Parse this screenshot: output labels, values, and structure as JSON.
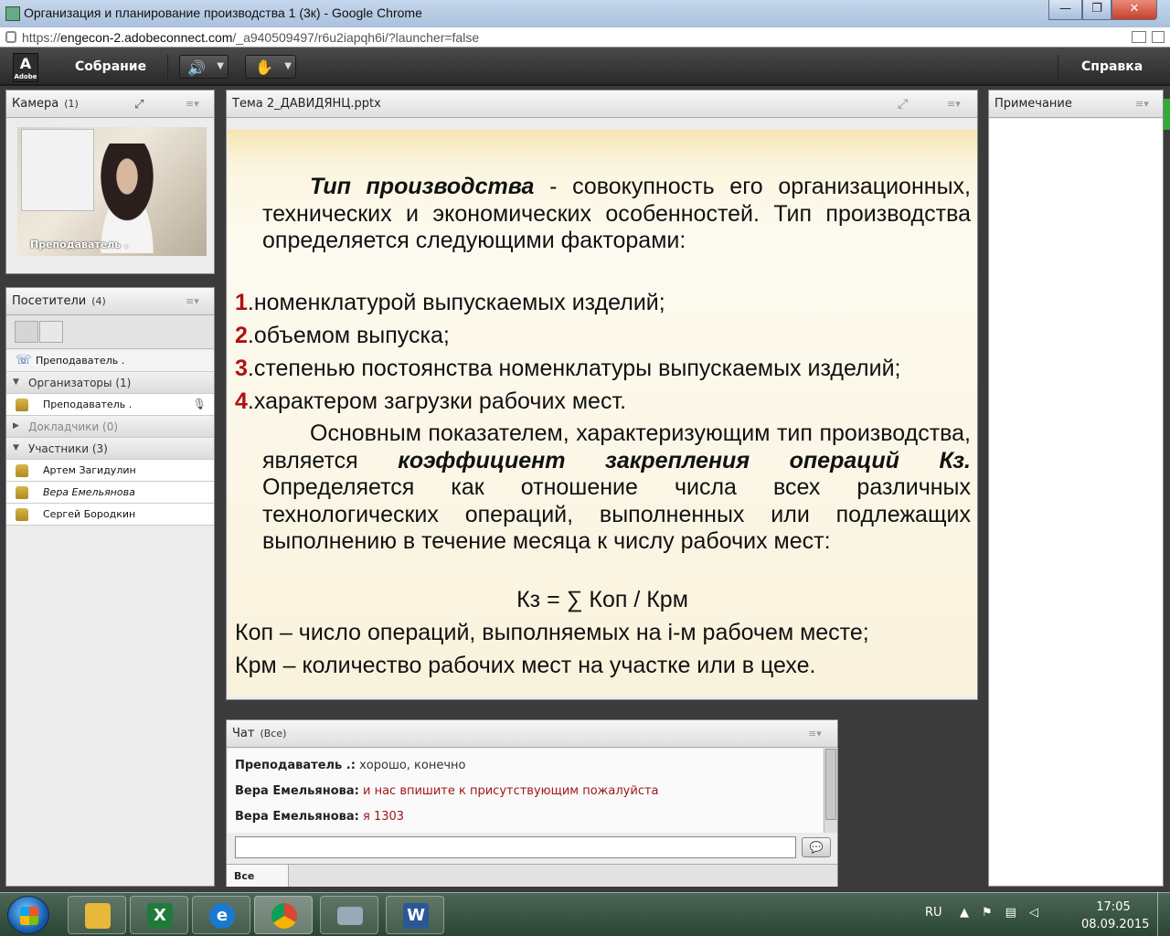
{
  "browser": {
    "window_title": "Организация и планирование производства 1 (3к) - Google Chrome",
    "url_scheme": "https://",
    "url_host": "engecon-2.adobeconnect.com",
    "url_path": "/_a940509497/r6u2iapqh6i/?launcher=false",
    "btn_min": "—",
    "btn_max": "❐",
    "btn_close": "✕"
  },
  "menubar": {
    "logo": "A",
    "logo_sub": "Adobe",
    "meeting": "Собрание",
    "help": "Справка"
  },
  "camera_pod": {
    "title": "Камера",
    "count": "(1)",
    "video_label": "Преподаватель ."
  },
  "attendees_pod": {
    "title": "Посетители",
    "count": "(4)",
    "phone_user": "Преподаватель .",
    "groups": [
      {
        "label": "Организаторы (1)",
        "users": [
          "Преподаватель ."
        ]
      },
      {
        "label": "Докладчики (0)",
        "users": []
      },
      {
        "label": "Участники (3)",
        "users": [
          "Артем Загидулин",
          "Вера Емельянова",
          "Сергей Бородкин"
        ]
      }
    ]
  },
  "slide_pod": {
    "title": "Тема 2_ДАВИДЯНЦ.pptx",
    "slide": {
      "intro_term": "Тип производства",
      "intro_rest": " - совокупность его организационных, технических и экономических особенностей. Тип производства определяется следующими факторами:",
      "items": [
        {
          "num": "1",
          "text": ".номенклатурой выпускаемых изделий;"
        },
        {
          "num": "2",
          "text": ".объемом выпуска;"
        },
        {
          "num": "3",
          "text": ".степенью постоянства номенклатуры выпускаемых изделий;"
        },
        {
          "num": "4",
          "text": ".характером загрузки рабочих мест."
        }
      ],
      "para2_start": "Основным показателем, характеризующим тип производства, является ",
      "para2_term": "коэффициент закрепления операций Кз.",
      "para2_rest": " Определяется как отношение числа всех различных технологических операций, выполненных или подлежащих выполнению в течение месяца к числу рабочих мест:",
      "formula": "Кз = ∑ Коп / Крм",
      "def1": "Коп – число операций, выполняемых на i-м рабочем месте;",
      "def2": "Крм – количество рабочих мест на участке или в цехе."
    }
  },
  "chat_pod": {
    "title": "Чат",
    "scope": "(Все)",
    "messages": [
      {
        "who": "Преподаватель .:",
        "text": "хорошо, конечно"
      },
      {
        "who": "Вера Емельянова:",
        "text": "и нас впишите к присутствующим пожалуйста"
      },
      {
        "who": "Вера Емельянова:",
        "text": "я 1303"
      }
    ],
    "tab_all": "Все"
  },
  "notes_pod": {
    "title": "Примечание"
  },
  "taskbar": {
    "lang": "RU",
    "time": "17:05",
    "date": "08.09.2015",
    "apps": [
      "folder-icon",
      "excel-icon",
      "ie-icon",
      "chrome-icon",
      "keyboard-icon",
      "word-icon"
    ]
  },
  "colors": {
    "slide_number_red": "#b01010",
    "chat_red": "#a01818",
    "menubar_bg": "#333333",
    "speaker_green": "#44cc44"
  }
}
